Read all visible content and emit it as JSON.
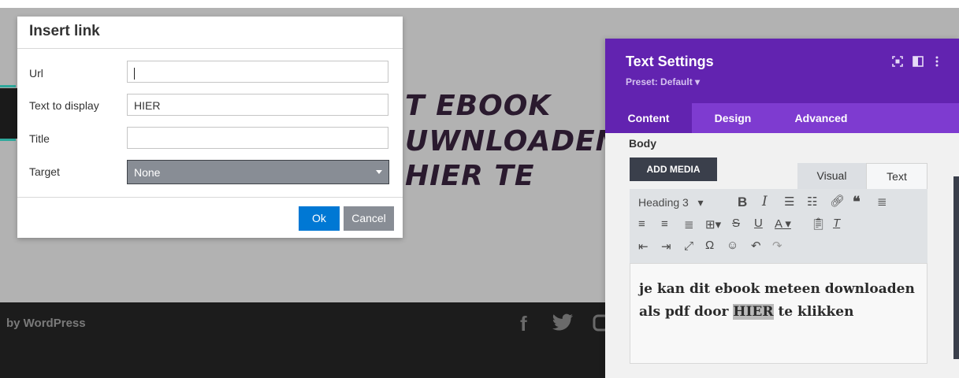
{
  "background": {
    "heading_lines": [
      "T EBOOK",
      "UWNLOADEN A",
      "HIER TE"
    ],
    "footer_credit": "by WordPress"
  },
  "dialog": {
    "title": "Insert link",
    "fields": {
      "url_label": "Url",
      "url_value": "",
      "text_label": "Text to display",
      "text_value": "HIER",
      "title_label": "Title",
      "title_value": "",
      "target_label": "Target",
      "target_value": "None"
    },
    "ok_label": "Ok",
    "cancel_label": "Cancel"
  },
  "panel": {
    "title": "Text Settings",
    "preset": "Preset: Default ▾",
    "tabs": [
      "Content",
      "Design",
      "Advanced"
    ],
    "active_tab": "Content",
    "body_label": "Body",
    "add_media_label": "ADD MEDIA",
    "editor_tabs": [
      "Visual",
      "Text"
    ],
    "format_select": "Heading 3",
    "editor_content": {
      "before": "je kan dit ebook meteen downloaden als pdf door ",
      "highlight": "HIER",
      "after": " te klikken"
    }
  },
  "colors": {
    "panel_header": "#6223b0",
    "panel_tabs": "#7e3bd0",
    "ok_button": "#0078d4",
    "overlay": "#b2b2b2"
  }
}
